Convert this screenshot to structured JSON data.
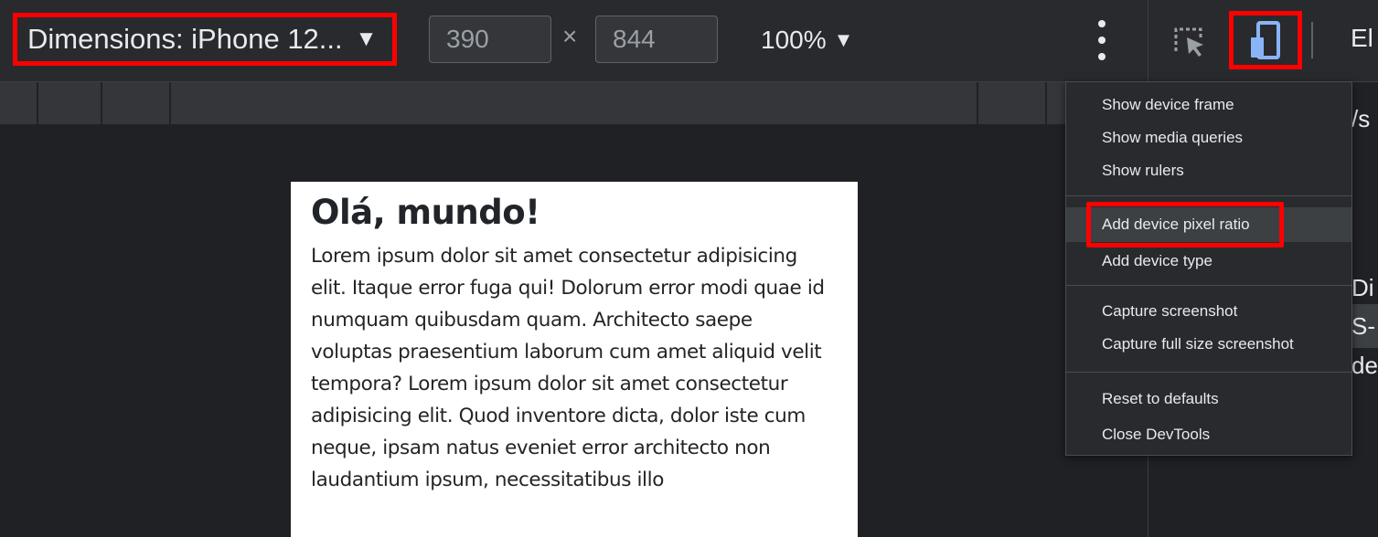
{
  "toolbar": {
    "dimensions_label": "Dimensions: iPhone 12...",
    "width_value": "390",
    "times_symbol": "×",
    "height_value": "844",
    "zoom_label": "100%",
    "caret": "▼",
    "elements_tab_label": "El"
  },
  "page": {
    "heading": "Olá, mundo!",
    "paragraph": "Lorem ipsum dolor sit amet consectetur adipisicing elit. Itaque error fuga qui! Dolorum error modi quae id numquam quibusdam quam. Architecto saepe voluptas praesentium laborum cum amet aliquid velit tempora? Lorem ipsum dolor sit amet consectetur adipisicing elit. Quod inventore dicta, dolor iste cum neque, ipsam natus eveniet error architecto non laudantium ipsum, necessitatibus illo"
  },
  "menu": {
    "items": [
      "Show device frame",
      "Show media queries",
      "Show rulers",
      "Add device pixel ratio",
      "Add device type",
      "Capture screenshot",
      "Capture full size screenshot",
      "Reset to defaults",
      "Close DevTools"
    ]
  },
  "side_panel": {
    "fragments": [
      "/s",
      "Di",
      "S-",
      "de"
    ]
  },
  "colors": {
    "highlight": "#ff0000",
    "accent_blue": "#8ab4f8",
    "toolbar_bg": "#292a2d",
    "canvas_bg": "#202124"
  }
}
